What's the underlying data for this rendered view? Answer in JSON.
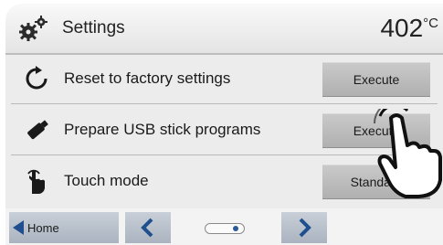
{
  "header": {
    "title": "Settings",
    "temperature": "402",
    "unit": "°C",
    "icon": "gears-icon"
  },
  "rows": [
    {
      "label": "Reset to factory settings",
      "button": "Execute",
      "icon": "reset-icon"
    },
    {
      "label": "Prepare USB stick programs",
      "button": "Execute",
      "icon": "usb-stick-icon"
    },
    {
      "label": "Touch mode",
      "button": "Standard",
      "icon": "touch-hand-icon"
    }
  ],
  "footer": {
    "home_label": "Home",
    "prev_icon": "chevron-left-icon",
    "next_icon": "chevron-right-icon",
    "page_indicator": "page 2 of 2"
  },
  "colors": {
    "accent": "#1f4f8e",
    "button": "#bdbdbd",
    "nav_button": "#b8c0cb"
  }
}
